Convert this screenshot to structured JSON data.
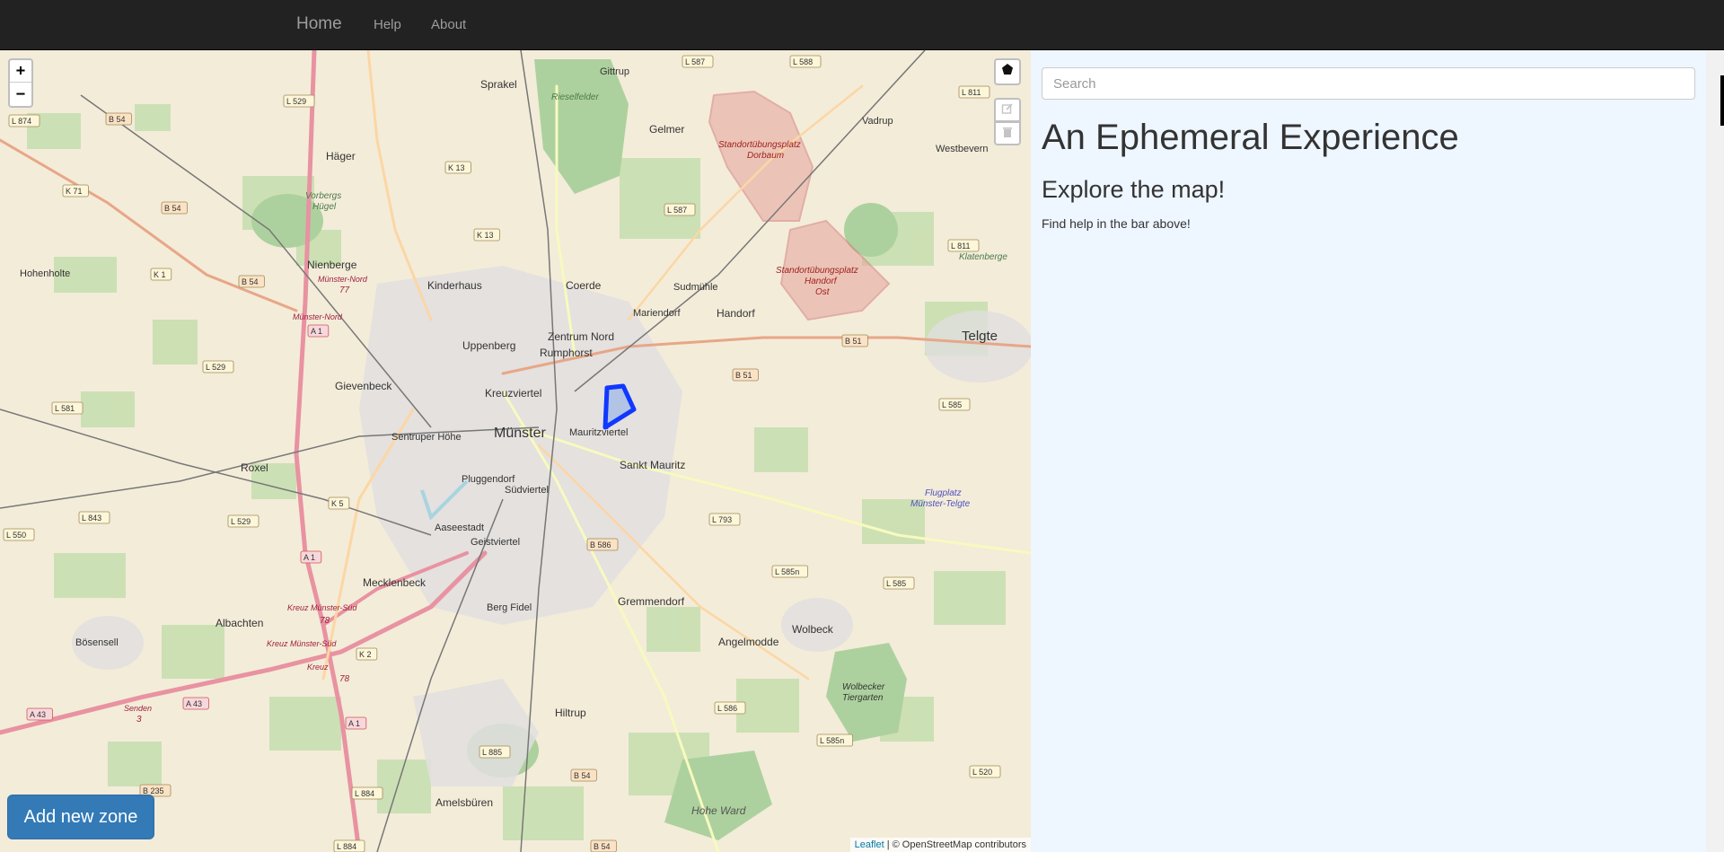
{
  "navbar": {
    "brand": "Home",
    "links": [
      "Help",
      "About"
    ]
  },
  "map": {
    "zoom_in": "+",
    "zoom_out": "−",
    "add_zone_label": "Add new zone",
    "attribution_leaflet": "Leaflet",
    "attribution_rest": " | © OpenStreetMap contributors",
    "places": {
      "sprakel": "Sprakel",
      "gittrup": "Gittrup",
      "gelmer": "Gelmer",
      "hager": "Häger",
      "vadrup": "Vadrup",
      "westbevern": "Westbevern",
      "nienberge": "Nienberge",
      "kinderhaus": "Kinderhaus",
      "coerde": "Coerde",
      "sudmuhle": "Sudmühle",
      "handorf": "Handorf",
      "mariendorf": "Mariendorf",
      "uppenberg": "Uppenberg",
      "zentrum_nord": "Zentrum Nord",
      "rumphorst": "Rumphorst",
      "gievenbeck": "Gievenbeck",
      "kreuzviertel": "Kreuzviertel",
      "munster": "Münster",
      "mauritzviertel": "Mauritzviertel",
      "sentruper_hohe": "Sentruper Höhe",
      "roxel": "Roxel",
      "sankt_mauritz": "Sankt Mauritz",
      "pluggendorf": "Pluggendorf",
      "sudviertel": "Südviertel",
      "aaseestadt": "Aaseestadt",
      "geistviertel": "Geistviertel",
      "mecklenbeck": "Mecklenbeck",
      "berg_fidel": "Berg Fidel",
      "gremmendorf": "Gremmendorf",
      "albachten": "Albachten",
      "bosensell": "Bösensell",
      "angelmodde": "Angelmodde",
      "wolbeck": "Wolbeck",
      "hiltrup": "Hiltrup",
      "amelsburen": "Amelsbüren",
      "hohe_ward": "Hohe Ward",
      "telgte": "Telgte",
      "hohenholte": "Hohenholte",
      "klatenberge": "Klatenberge",
      "rieselfelder": "Rieselfelder",
      "vorbergs": "Vorbergs",
      "hugel": "Hügel",
      "standort1a": "Standortübungsplatz",
      "standort1b": "Dorbaum",
      "standort2a": "Standortübungsplatz",
      "standort2b": "Handorf",
      "standort2c": "Ost",
      "flugplatz": "Flugplatz",
      "flugplatz2": "Münster-Telgte",
      "wolbecker": "Wolbecker",
      "tiergarten": "Tiergarten",
      "ms_nord": "Münster-Nord",
      "ms_nord2": "Münster-Nord",
      "kreuz_ms_sud": "Kreuz Münster-Süd",
      "kreuz_ms_sud2": "Kreuz Münster-Süd",
      "kreuz": "Kreuz",
      "senden": "Senden",
      "a77": "77",
      "a78": "78",
      "a78b": "78",
      "a3": "3"
    },
    "roads": [
      "L 587",
      "L 588",
      "L 811",
      "B 54",
      "L 874",
      "L 529",
      "K 13",
      "K 71",
      "L 587",
      "K 13",
      "B 54",
      "K 1",
      "B 54",
      "A 1",
      "L 811",
      "L 529",
      "L 581",
      "B 51",
      "B 51",
      "L 585",
      "K 5",
      "L 843",
      "L 529",
      "L 550",
      "B 586",
      "L 793",
      "A 1",
      "L 585n",
      "L 585",
      "K 2",
      "A 43",
      "A 43",
      "A 1",
      "L 586",
      "L 585n",
      "L 885",
      "L 520",
      "B 235",
      "L 884",
      "B 54",
      "L 884",
      "B 54"
    ]
  },
  "sidebar": {
    "search_placeholder": "Search",
    "title": "An Ephemeral Experience",
    "subtitle": "Explore the map!",
    "help_text": "Find help in the bar above!"
  }
}
